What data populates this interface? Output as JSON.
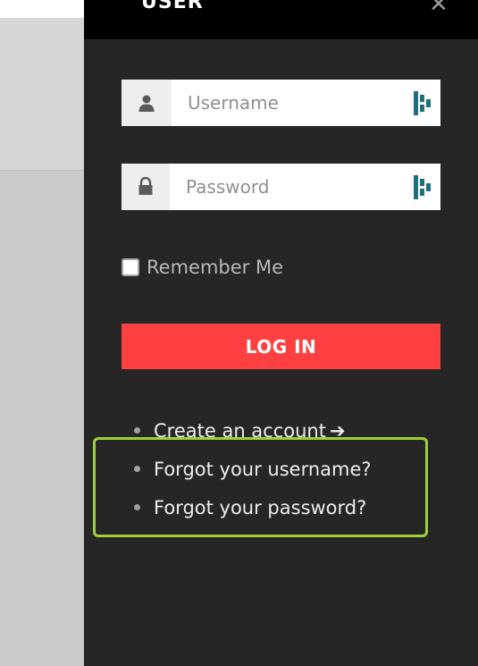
{
  "modal": {
    "title": "USER",
    "close_icon": "close-icon",
    "username": {
      "placeholder": "Username",
      "value": "",
      "icon": "user-icon"
    },
    "password": {
      "placeholder": "Password",
      "value": "",
      "icon": "lock-icon"
    },
    "password_manager_icon": "keeper-icon",
    "remember_label": "Remember Me",
    "remember_checked": false,
    "login_label": "LOG IN",
    "links": [
      {
        "label": "Create an account",
        "icon": "arrow-right-icon"
      },
      {
        "label": "Forgot your username?"
      },
      {
        "label": "Forgot your password?"
      }
    ],
    "colors": {
      "panel": "#262626",
      "header": "#000000",
      "login_button": "#ff4040",
      "highlight": "#9cd13a"
    }
  }
}
